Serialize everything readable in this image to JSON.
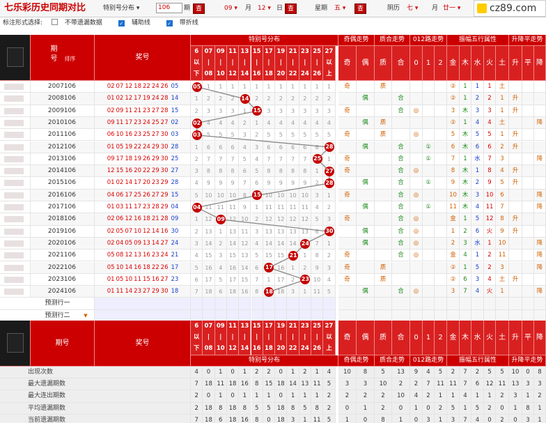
{
  "title": "七乐彩历史同期对比",
  "toolbar": {
    "dist_select": "特别号分布",
    "period_value": "106",
    "period_unit": "期",
    "query": "查",
    "month_value": "09",
    "month_unit": "月",
    "day_value": "12",
    "day_unit": "日",
    "weekday_label": "星期",
    "weekday_value": "五",
    "lunar_label": "阴历",
    "lunar_month": "七",
    "lunar_month_unit": "月",
    "lunar_day": "廿一",
    "logo_text": "cz89.com"
  },
  "options": {
    "label": "标注形式选择:",
    "opt1": "不带遗漏数据",
    "opt1_on": false,
    "opt2": "辅助线",
    "opt2_on": true,
    "opt3": "带折线",
    "opt3_on": true
  },
  "headers": {
    "issue": "期号",
    "sort": "排序",
    "numbers": "奖号",
    "dist": "特别号分布",
    "oe": "奇偶走势",
    "pc": "质合走势",
    "r012": "012路走势",
    "zf": "振幅五行属性",
    "sjp": "升降平走势",
    "odd": "奇",
    "even": "偶",
    "prime": "质",
    "comp": "合",
    "r0": "0",
    "r1": "1",
    "r2": "2",
    "wx": [
      "金",
      "木",
      "水",
      "火",
      "土"
    ],
    "s": "升",
    "p": "平",
    "j": "降"
  },
  "dist_cols": [
    [
      "6",
      "以",
      "下"
    ],
    [
      "07",
      "|",
      "08"
    ],
    [
      "09",
      "|",
      "10"
    ],
    [
      "11",
      "|",
      "12"
    ],
    [
      "13",
      "|",
      "14"
    ],
    [
      "15",
      "|",
      "16"
    ],
    [
      "17",
      "|",
      "18"
    ],
    [
      "19",
      "|",
      "20"
    ],
    [
      "21",
      "|",
      "22"
    ],
    [
      "23",
      "|",
      "24"
    ],
    [
      "25",
      "|",
      "26"
    ],
    [
      "27",
      "以",
      "上"
    ]
  ],
  "rows": [
    {
      "issue": "2007106",
      "nums": [
        "02",
        "07",
        "12",
        "18",
        "22",
        "24",
        "26"
      ],
      "sp": "05",
      "hit": 0,
      "dist": [
        "",
        "1",
        "1",
        "1",
        "1",
        "1",
        "1",
        "1",
        "1",
        "1",
        "1",
        "1"
      ],
      "oe": "奇",
      "pc": "质",
      "r012": "",
      "wx": [
        "②",
        "1",
        "1",
        "1",
        "土"
      ],
      "sjp": ""
    },
    {
      "issue": "2008106",
      "nums": [
        "01",
        "02",
        "12",
        "17",
        "19",
        "24",
        "28"
      ],
      "sp": "14",
      "hit": 4,
      "dist": [
        "1",
        "2",
        "2",
        "2",
        "",
        "2",
        "2",
        "2",
        "2",
        "2",
        "2",
        "2"
      ],
      "oe": "偶",
      "pc": "合",
      "r012": "",
      "wx": [
        "②",
        "1",
        "2",
        "2",
        "1"
      ],
      "sjp": "升"
    },
    {
      "issue": "2009106",
      "nums": [
        "02",
        "09",
        "11",
        "21",
        "23",
        "27",
        "28"
      ],
      "sp": "15",
      "hit": 5,
      "dist": [
        "2",
        "3",
        "3",
        "3",
        "1",
        "",
        "3",
        "3",
        "3",
        "3",
        "3",
        "3"
      ],
      "oe": "奇",
      "pc": "合",
      "r012": "0",
      "wx": [
        "3",
        "木",
        "3",
        "3",
        "1"
      ],
      "sjp": "升"
    },
    {
      "issue": "2010106",
      "nums": [
        "09",
        "11",
        "17",
        "23",
        "24",
        "25",
        "27"
      ],
      "sp": "02",
      "hit": 0,
      "dist": [
        "",
        "4",
        "4",
        "4",
        "2",
        "1",
        "4",
        "4",
        "4",
        "4",
        "4",
        "4"
      ],
      "oe": "偶",
      "pc": "质",
      "r012": "",
      "wx": [
        "②",
        "1",
        "4",
        "4",
        "土"
      ],
      "sjp": "降"
    },
    {
      "issue": "2011106",
      "nums": [
        "06",
        "10",
        "16",
        "23",
        "25",
        "27",
        "30"
      ],
      "sp": "03",
      "hit": 0,
      "dist": [
        "",
        "5",
        "5",
        "5",
        "3",
        "2",
        "5",
        "5",
        "5",
        "5",
        "5",
        "5"
      ],
      "oe": "奇",
      "pc": "质",
      "r012": "0",
      "wx": [
        "5",
        "木",
        "5",
        "5",
        "1"
      ],
      "sjp": "升"
    },
    {
      "issue": "2012106",
      "nums": [
        "01",
        "05",
        "19",
        "22",
        "24",
        "29",
        "30"
      ],
      "sp": "28",
      "hit": 11,
      "dist": [
        "1",
        "6",
        "6",
        "6",
        "4",
        "3",
        "6",
        "6",
        "6",
        "6",
        "6",
        ""
      ],
      "oe": "偶",
      "pc": "合",
      "r012": "①",
      "wx": [
        "6",
        "木",
        "6",
        "6",
        "2"
      ],
      "sjp": "升"
    },
    {
      "issue": "2013106",
      "nums": [
        "09",
        "17",
        "18",
        "19",
        "26",
        "29",
        "30"
      ],
      "sp": "25",
      "hit": 10,
      "dist": [
        "2",
        "7",
        "7",
        "7",
        "5",
        "4",
        "7",
        "7",
        "7",
        "7",
        "",
        "1"
      ],
      "oe": "奇",
      "pc": "合",
      "r012": "①",
      "wx": [
        "7",
        "1",
        "水",
        "7",
        "3"
      ],
      "sjp": "降"
    },
    {
      "issue": "2014106",
      "nums": [
        "12",
        "15",
        "16",
        "20",
        "22",
        "29",
        "30"
      ],
      "sp": "27",
      "hit": 11,
      "dist": [
        "3",
        "8",
        "8",
        "8",
        "6",
        "5",
        "8",
        "8",
        "8",
        "8",
        "1",
        ""
      ],
      "oe": "奇",
      "pc": "合",
      "r012": "0",
      "wx": [
        "8",
        "木",
        "1",
        "8",
        "4"
      ],
      "sjp": "升"
    },
    {
      "issue": "2015106",
      "nums": [
        "01",
        "02",
        "14",
        "17",
        "20",
        "23",
        "29"
      ],
      "sp": "28",
      "hit": 11,
      "dist": [
        "4",
        "9",
        "9",
        "9",
        "7",
        "6",
        "9",
        "9",
        "9",
        "9",
        "2",
        ""
      ],
      "oe": "偶",
      "pc": "合",
      "r012": "①",
      "wx": [
        "9",
        "木",
        "2",
        "9",
        "5"
      ],
      "sjp": "升"
    },
    {
      "issue": "2016106",
      "nums": [
        "04",
        "06",
        "17",
        "25",
        "26",
        "27",
        "29"
      ],
      "sp": "15",
      "hit": 5,
      "dist": [
        "5",
        "10",
        "10",
        "10",
        "8",
        "",
        "10",
        "10",
        "10",
        "10",
        "3",
        "1"
      ],
      "oe": "奇",
      "pc": "合",
      "r012": "0",
      "wx": [
        "10",
        "木",
        "3",
        "10",
        "6"
      ],
      "sjp": "降"
    },
    {
      "issue": "2017106",
      "nums": [
        "01",
        "03",
        "11",
        "17",
        "23",
        "28",
        "29"
      ],
      "sp": "04",
      "hit": 0,
      "dist": [
        "",
        "11",
        "11",
        "11",
        "9",
        "1",
        "11",
        "11",
        "11",
        "11",
        "4",
        "2"
      ],
      "oe": "偶",
      "pc": "合",
      "r012": "①",
      "wx": [
        "11",
        "木",
        "4",
        "11",
        "7"
      ],
      "sjp": "降"
    },
    {
      "issue": "2018106",
      "nums": [
        "02",
        "06",
        "12",
        "16",
        "18",
        "21",
        "28"
      ],
      "sp": "09",
      "hit": 2,
      "dist": [
        "1",
        "12",
        "",
        "12",
        "10",
        "2",
        "12",
        "12",
        "12",
        "12",
        "5",
        "3"
      ],
      "oe": "奇",
      "pc": "合",
      "r012": "0",
      "wx": [
        "金",
        "1",
        "5",
        "12",
        "8"
      ],
      "sjp": "升"
    },
    {
      "issue": "2019106",
      "nums": [
        "02",
        "05",
        "07",
        "10",
        "12",
        "14",
        "16"
      ],
      "sp": "30",
      "hit": 11,
      "dist": [
        "2",
        "13",
        "1",
        "13",
        "11",
        "3",
        "13",
        "13",
        "13",
        "13",
        "6",
        ""
      ],
      "oe": "偶",
      "pc": "合",
      "r012": "0",
      "wx": [
        "1",
        "2",
        "6",
        "火",
        "9"
      ],
      "sjp": "升"
    },
    {
      "issue": "2020106",
      "nums": [
        "02",
        "04",
        "05",
        "09",
        "13",
        "14",
        "27"
      ],
      "sp": "24",
      "hit": 9,
      "dist": [
        "3",
        "14",
        "2",
        "14",
        "12",
        "4",
        "14",
        "14",
        "14",
        "",
        "7",
        "1"
      ],
      "oe": "偶",
      "pc": "合",
      "r012": "0",
      "wx": [
        "2",
        "3",
        "水",
        "1",
        "10"
      ],
      "sjp": "降"
    },
    {
      "issue": "2021106",
      "nums": [
        "05",
        "08",
        "12",
        "13",
        "16",
        "23",
        "24"
      ],
      "sp": "21",
      "hit": 8,
      "dist": [
        "4",
        "15",
        "3",
        "15",
        "13",
        "5",
        "15",
        "15",
        "",
        "1",
        "8",
        "2"
      ],
      "oe": "奇",
      "pc": "合",
      "r012": "0",
      "wx": [
        "金",
        "4",
        "1",
        "2",
        "11"
      ],
      "sjp": "降"
    },
    {
      "issue": "2022106",
      "nums": [
        "05",
        "10",
        "14",
        "16",
        "18",
        "22",
        "26"
      ],
      "sp": "17",
      "hit": 6,
      "dist": [
        "5",
        "16",
        "4",
        "16",
        "14",
        "6",
        "",
        "16",
        "1",
        "2",
        "9",
        "3"
      ],
      "oe": "奇",
      "pc": "质",
      "r012": "",
      "wx": [
        "②",
        "1",
        "5",
        "2",
        "3"
      ],
      "sjp": "降"
    },
    {
      "issue": "2023106",
      "nums": [
        "01",
        "05",
        "10",
        "11",
        "15",
        "16",
        "27"
      ],
      "sp": "23",
      "hit": 9,
      "dist": [
        "6",
        "17",
        "5",
        "17",
        "15",
        "7",
        "1",
        "17",
        "2",
        "",
        "10",
        "4"
      ],
      "oe": "奇",
      "pc": "质",
      "r012": "",
      "wx": [
        "②",
        "6",
        "3",
        "4",
        "土"
      ],
      "sjp": "升"
    },
    {
      "issue": "2024106",
      "nums": [
        "01",
        "11",
        "14",
        "23",
        "27",
        "29",
        "30"
      ],
      "sp": "18",
      "hit": 6,
      "dist": [
        "7",
        "18",
        "6",
        "18",
        "16",
        "8",
        "",
        "18",
        "3",
        "1",
        "11",
        "5"
      ],
      "oe": "偶",
      "pc": "合",
      "r012": "0",
      "wx": [
        "3",
        "7",
        "4",
        "火",
        "1"
      ],
      "sjp": "降"
    }
  ],
  "predict": [
    "预测行一",
    "预测行二"
  ],
  "stats": [
    {
      "label": "出现次数",
      "vals": [
        "4",
        "0",
        "1",
        "0",
        "1",
        "2",
        "2",
        "0",
        "1",
        "2",
        "1",
        "4",
        "10",
        "8",
        "5",
        "13",
        "9",
        "4",
        "5",
        "2",
        "7",
        "2",
        "5",
        "5",
        "10",
        "0",
        "8"
      ]
    },
    {
      "label": "最大遗漏期数",
      "vals": [
        "7",
        "18",
        "11",
        "18",
        "16",
        "8",
        "15",
        "18",
        "14",
        "13",
        "11",
        "5",
        "3",
        "3",
        "10",
        "2",
        "2",
        "7",
        "11",
        "11",
        "7",
        "6",
        "12",
        "11",
        "13",
        "3",
        "3"
      ]
    },
    {
      "label": "最大连出期数",
      "vals": [
        "2",
        "0",
        "1",
        "0",
        "1",
        "1",
        "1",
        "0",
        "1",
        "1",
        "1",
        "2",
        "2",
        "2",
        "2",
        "10",
        "4",
        "2",
        "1",
        "1",
        "4",
        "1",
        "1",
        "2",
        "3",
        "1",
        "2"
      ]
    },
    {
      "label": "平均遗漏期数",
      "vals": [
        "2",
        "18",
        "8",
        "18",
        "8",
        "5",
        "5",
        "18",
        "8",
        "5",
        "8",
        "2",
        "0",
        "1",
        "2",
        "0",
        "1",
        "0",
        "2",
        "5",
        "1",
        "5",
        "2",
        "0",
        "1",
        "8",
        "1"
      ]
    },
    {
      "label": "当前遗漏期数",
      "vals": [
        "7",
        "18",
        "6",
        "18",
        "16",
        "8",
        "0",
        "18",
        "3",
        "1",
        "11",
        "5",
        "1",
        "0",
        "8",
        "1",
        "0",
        "3",
        "1",
        "3",
        "7",
        "4",
        "0",
        "2",
        "0",
        "3",
        "1"
      ]
    }
  ]
}
